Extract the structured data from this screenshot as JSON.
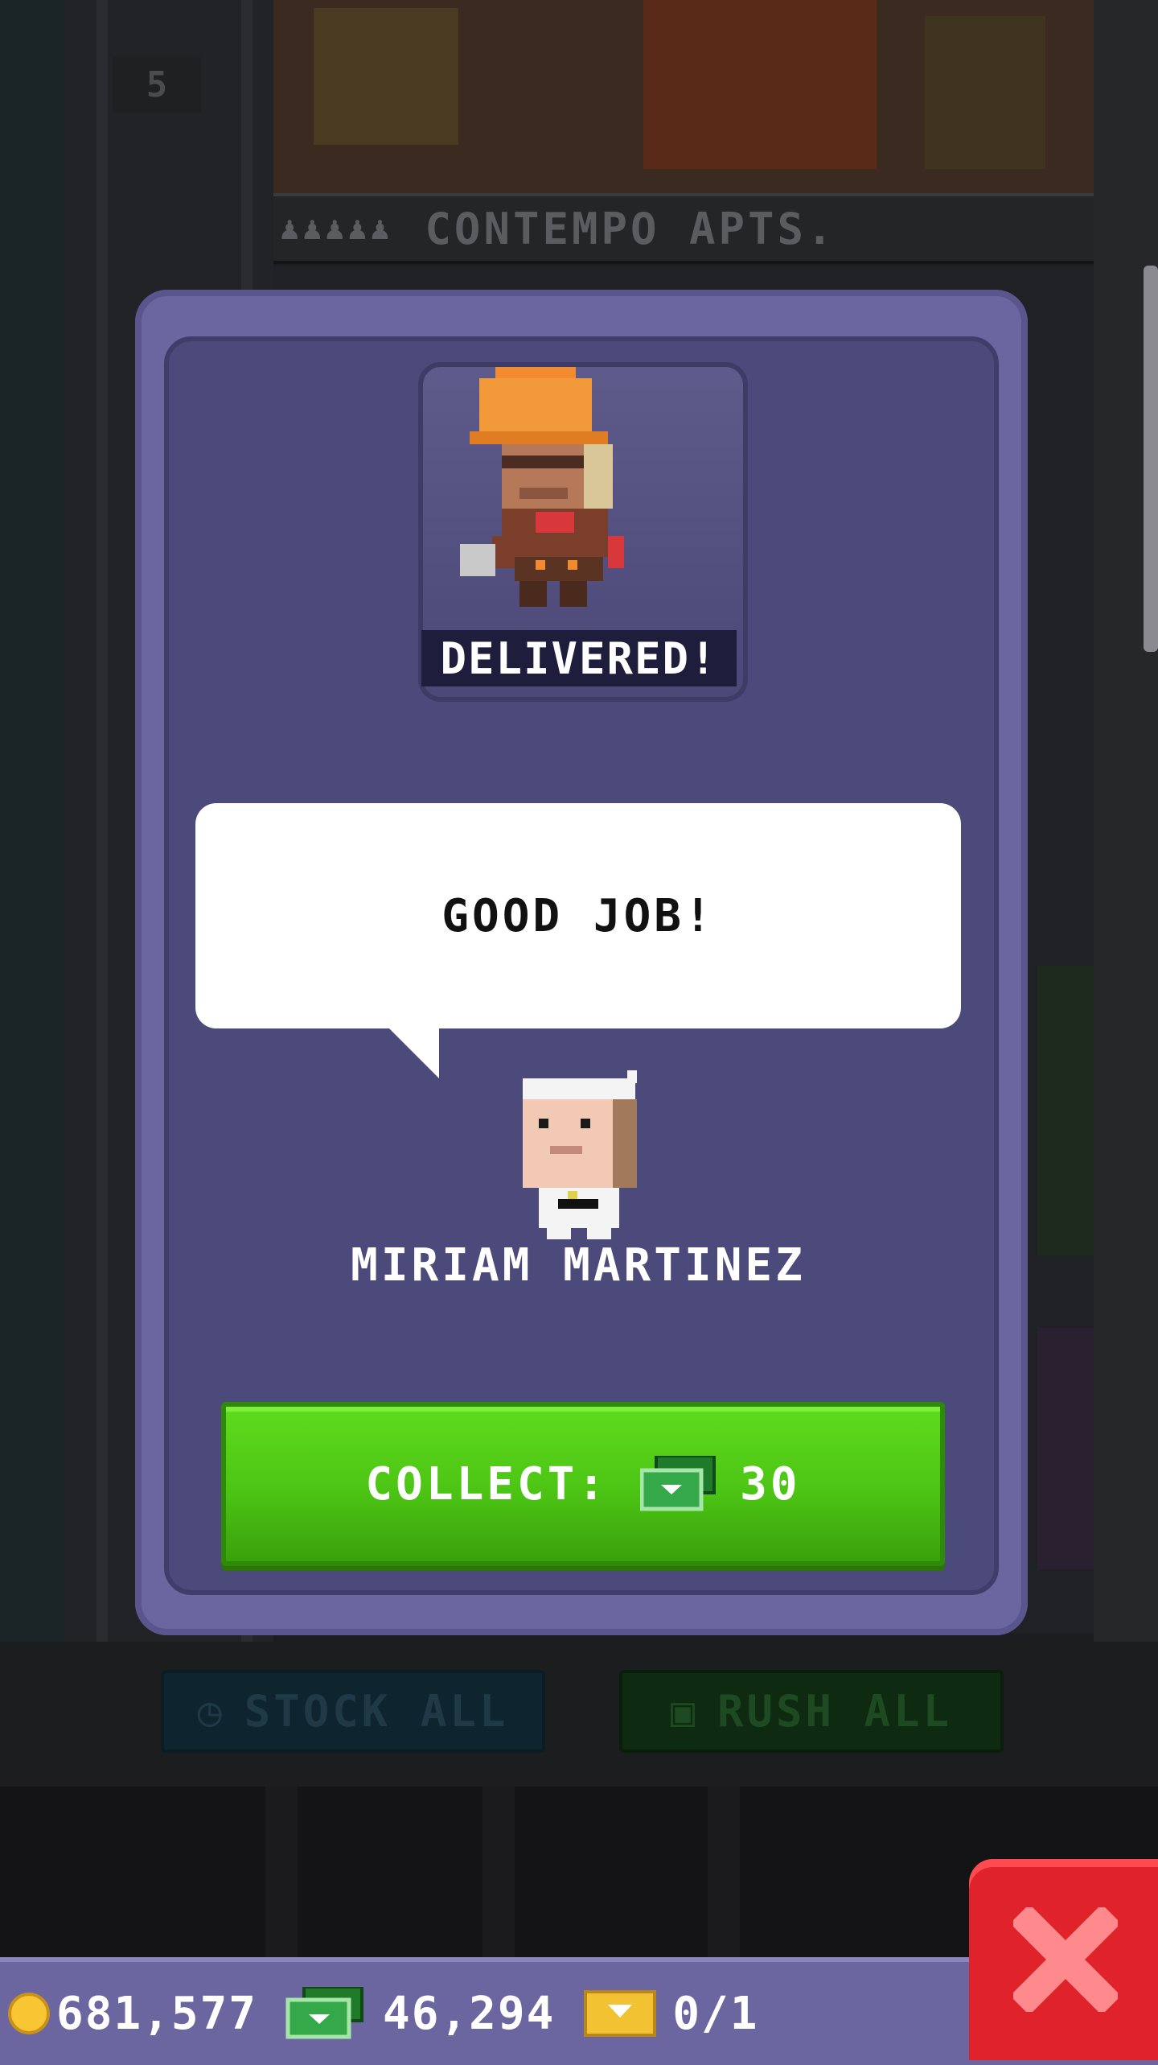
{
  "floor": {
    "number": "5",
    "name": "CONTEMPO APTS.",
    "occupancy_icon": "person-icons"
  },
  "background_buttons": {
    "stock_all": "STOCK ALL",
    "rush_all": "RUSH ALL"
  },
  "modal": {
    "status_label": "DELIVERED!",
    "speech": "GOOD JOB!",
    "npc_name": "MIRIAM MARTINEZ",
    "collect_label": "COLLECT:",
    "collect_amount": "30",
    "collect_currency_icon": "tower-bux-icon"
  },
  "status_bar": {
    "coins": "681,577",
    "bux": "46,294",
    "tickets": "0/1"
  },
  "colors": {
    "modal": "#6b66a0",
    "collect_green": "#4cc414",
    "close_red": "#e0232a"
  }
}
